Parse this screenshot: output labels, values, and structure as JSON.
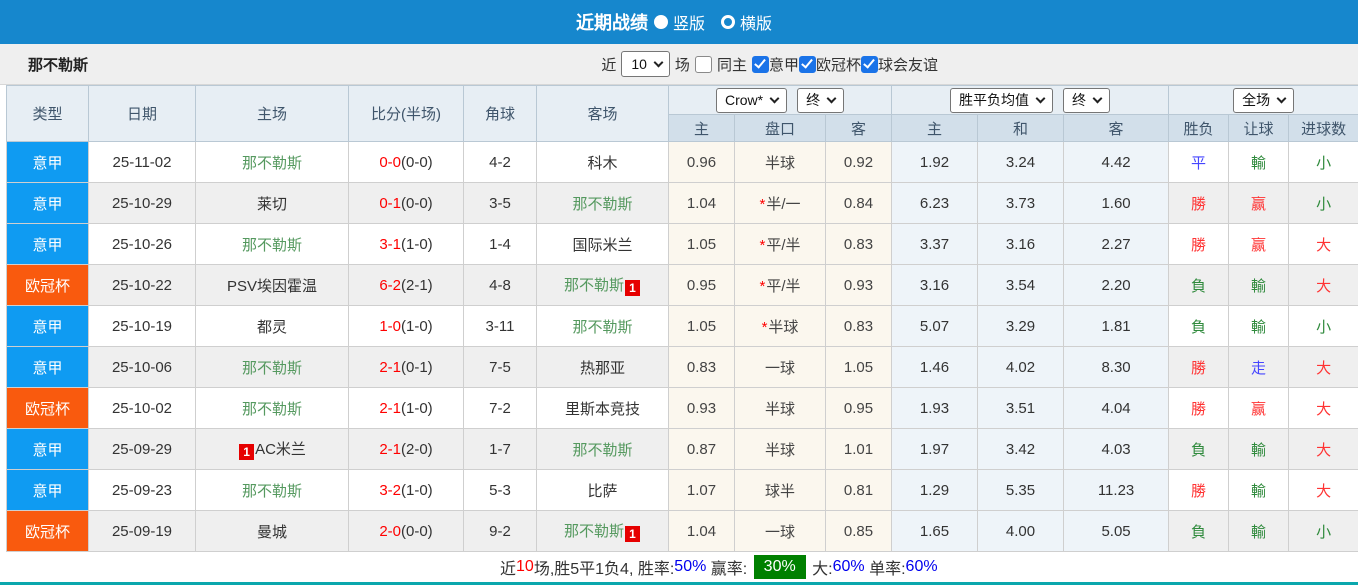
{
  "topbar": {
    "title": "近期战绩",
    "options": [
      {
        "label": "竖版",
        "selected": true
      },
      {
        "label": "横版",
        "selected": false
      }
    ]
  },
  "filterbar": {
    "team": "那不勒斯",
    "recent_label": "近",
    "recent_value": "10",
    "unit_label": "场",
    "same_home_label": "同主",
    "same_home_checked": false,
    "league_filters": [
      {
        "label": "意甲",
        "checked": true
      },
      {
        "label": "欧冠杯",
        "checked": true
      },
      {
        "label": "球会友谊",
        "checked": true
      }
    ]
  },
  "table": {
    "headers": {
      "type": "类型",
      "date": "日期",
      "home": "主场",
      "score": "比分(半场)",
      "corner": "角球",
      "away": "客场",
      "odds_home": "主",
      "handicap": "盘口",
      "odds_away": "客",
      "mean_home": "主",
      "mean_draw": "和",
      "mean_away": "客",
      "result": "胜负",
      "handicap_result": "让球",
      "goals": "进球数"
    },
    "selects": {
      "company": "Crow*",
      "company_time": "终",
      "mean": "胜平负均值",
      "mean_time": "终",
      "scope": "全场"
    },
    "rows": [
      {
        "league": "意甲",
        "league_color": "#0f9bf2",
        "date": "25-11-02",
        "home": {
          "name": "那不勒斯",
          "highlight": true
        },
        "score": "0-0",
        "half_score": "(0-0)",
        "corners": "4-2",
        "away": {
          "name": "科木",
          "highlight": false
        },
        "odds": {
          "home": "0.96",
          "star": false,
          "handicap": "半球",
          "away": "0.92"
        },
        "mean": {
          "home": "1.92",
          "draw": "3.24",
          "away": "4.42"
        },
        "results": {
          "outcome": {
            "text": "平",
            "color": "blue"
          },
          "handicap": {
            "text": "輸",
            "color": "green"
          },
          "goals": {
            "text": "小",
            "color": "green"
          }
        }
      },
      {
        "league": "意甲",
        "league_color": "#0f9bf2",
        "date": "25-10-29",
        "home": {
          "name": "莱切",
          "highlight": false
        },
        "score": "0-1",
        "half_score": "(0-0)",
        "corners": "3-5",
        "away": {
          "name": "那不勒斯",
          "highlight": true
        },
        "odds": {
          "home": "1.04",
          "star": true,
          "handicap": "半/一",
          "away": "0.84"
        },
        "mean": {
          "home": "6.23",
          "draw": "3.73",
          "away": "1.60"
        },
        "results": {
          "outcome": {
            "text": "勝",
            "color": "red"
          },
          "handicap": {
            "text": "赢",
            "color": "red"
          },
          "goals": {
            "text": "小",
            "color": "green"
          }
        }
      },
      {
        "league": "意甲",
        "league_color": "#0f9bf2",
        "date": "25-10-26",
        "home": {
          "name": "那不勒斯",
          "highlight": true
        },
        "score": "3-1",
        "half_score": "(1-0)",
        "corners": "1-4",
        "away": {
          "name": "国际米兰",
          "highlight": false
        },
        "odds": {
          "home": "1.05",
          "star": true,
          "handicap": "平/半",
          "away": "0.83"
        },
        "mean": {
          "home": "3.37",
          "draw": "3.16",
          "away": "2.27"
        },
        "results": {
          "outcome": {
            "text": "勝",
            "color": "red"
          },
          "handicap": {
            "text": "赢",
            "color": "red"
          },
          "goals": {
            "text": "大",
            "color": "red"
          }
        }
      },
      {
        "league": "欧冠杯",
        "league_color": "#f95a0e",
        "date": "25-10-22",
        "home": {
          "name": "PSV埃因霍温",
          "highlight": false
        },
        "score": "6-2",
        "half_score": "(2-1)",
        "corners": "4-8",
        "away": {
          "name": "那不勒斯",
          "highlight": true,
          "badge": {
            "text": "1",
            "position": "after"
          }
        },
        "odds": {
          "home": "0.95",
          "star": true,
          "handicap": "平/半",
          "away": "0.93"
        },
        "mean": {
          "home": "3.16",
          "draw": "3.54",
          "away": "2.20"
        },
        "results": {
          "outcome": {
            "text": "負",
            "color": "green"
          },
          "handicap": {
            "text": "輸",
            "color": "green"
          },
          "goals": {
            "text": "大",
            "color": "red"
          }
        }
      },
      {
        "league": "意甲",
        "league_color": "#0f9bf2",
        "date": "25-10-19",
        "home": {
          "name": "都灵",
          "highlight": false
        },
        "score": "1-0",
        "half_score": "(1-0)",
        "corners": "3-11",
        "away": {
          "name": "那不勒斯",
          "highlight": true
        },
        "odds": {
          "home": "1.05",
          "star": true,
          "handicap": "半球",
          "away": "0.83"
        },
        "mean": {
          "home": "5.07",
          "draw": "3.29",
          "away": "1.81"
        },
        "results": {
          "outcome": {
            "text": "負",
            "color": "green"
          },
          "handicap": {
            "text": "輸",
            "color": "green"
          },
          "goals": {
            "text": "小",
            "color": "green"
          }
        }
      },
      {
        "league": "意甲",
        "league_color": "#0f9bf2",
        "date": "25-10-06",
        "home": {
          "name": "那不勒斯",
          "highlight": true
        },
        "score": "2-1",
        "half_score": "(0-1)",
        "corners": "7-5",
        "away": {
          "name": "热那亚",
          "highlight": false
        },
        "odds": {
          "home": "0.83",
          "star": false,
          "handicap": "一球",
          "away": "1.05"
        },
        "mean": {
          "home": "1.46",
          "draw": "4.02",
          "away": "8.30"
        },
        "results": {
          "outcome": {
            "text": "勝",
            "color": "red"
          },
          "handicap": {
            "text": "走",
            "color": "blue"
          },
          "goals": {
            "text": "大",
            "color": "red"
          }
        }
      },
      {
        "league": "欧冠杯",
        "league_color": "#f95a0e",
        "date": "25-10-02",
        "home": {
          "name": "那不勒斯",
          "highlight": true
        },
        "score": "2-1",
        "half_score": "(1-0)",
        "corners": "7-2",
        "away": {
          "name": "里斯本竞技",
          "highlight": false
        },
        "odds": {
          "home": "0.93",
          "star": false,
          "handicap": "半球",
          "away": "0.95"
        },
        "mean": {
          "home": "1.93",
          "draw": "3.51",
          "away": "4.04"
        },
        "results": {
          "outcome": {
            "text": "勝",
            "color": "red"
          },
          "handicap": {
            "text": "赢",
            "color": "red"
          },
          "goals": {
            "text": "大",
            "color": "red"
          }
        }
      },
      {
        "league": "意甲",
        "league_color": "#0f9bf2",
        "date": "25-09-29",
        "home": {
          "name": "AC米兰",
          "highlight": false,
          "badge": {
            "text": "1",
            "position": "before"
          }
        },
        "score": "2-1",
        "half_score": "(2-0)",
        "corners": "1-7",
        "away": {
          "name": "那不勒斯",
          "highlight": true
        },
        "odds": {
          "home": "0.87",
          "star": false,
          "handicap": "半球",
          "away": "1.01"
        },
        "mean": {
          "home": "1.97",
          "draw": "3.42",
          "away": "4.03"
        },
        "results": {
          "outcome": {
            "text": "負",
            "color": "green"
          },
          "handicap": {
            "text": "輸",
            "color": "green"
          },
          "goals": {
            "text": "大",
            "color": "red"
          }
        }
      },
      {
        "league": "意甲",
        "league_color": "#0f9bf2",
        "date": "25-09-23",
        "home": {
          "name": "那不勒斯",
          "highlight": true
        },
        "score": "3-2",
        "half_score": "(1-0)",
        "corners": "5-3",
        "away": {
          "name": "比萨",
          "highlight": false
        },
        "odds": {
          "home": "1.07",
          "star": false,
          "handicap": "球半",
          "away": "0.81"
        },
        "mean": {
          "home": "1.29",
          "draw": "5.35",
          "away": "11.23"
        },
        "results": {
          "outcome": {
            "text": "勝",
            "color": "red"
          },
          "handicap": {
            "text": "輸",
            "color": "green"
          },
          "goals": {
            "text": "大",
            "color": "red"
          }
        }
      },
      {
        "league": "欧冠杯",
        "league_color": "#f95a0e",
        "date": "25-09-19",
        "home": {
          "name": "曼城",
          "highlight": false
        },
        "score": "2-0",
        "half_score": "(0-0)",
        "corners": "9-2",
        "away": {
          "name": "那不勒斯",
          "highlight": true,
          "badge": {
            "text": "1",
            "position": "after"
          }
        },
        "odds": {
          "home": "1.04",
          "star": false,
          "handicap": "一球",
          "away": "0.85"
        },
        "mean": {
          "home": "1.65",
          "draw": "4.00",
          "away": "5.05"
        },
        "results": {
          "outcome": {
            "text": "負",
            "color": "green"
          },
          "handicap": {
            "text": "輸",
            "color": "green"
          },
          "goals": {
            "text": "小",
            "color": "green"
          }
        }
      }
    ]
  },
  "summary": {
    "segments": [
      {
        "text": "近",
        "style": "dark"
      },
      {
        "text": "10",
        "style": "red"
      },
      {
        "text": "场,胜5平1负4, 胜率:",
        "style": "dark"
      },
      {
        "text": "50%",
        "style": "blue"
      },
      {
        "text": " 赢率: ",
        "style": "dark"
      },
      {
        "text": "30%",
        "style": "greenbox"
      },
      {
        "text": " 大:",
        "style": "dark"
      },
      {
        "text": "60%",
        "style": "blue"
      },
      {
        "text": " 单率:",
        "style": "dark"
      },
      {
        "text": "60%",
        "style": "blue"
      }
    ]
  },
  "colors": {
    "topbar_blue": "#1687cd",
    "serie_a_blue": "#0f9bf2",
    "ucl_orange": "#f95a0e",
    "header_bg": "#d2dfea",
    "stripe_gray": "#efefef",
    "odds_cream": "#fbf7ee",
    "mean_blue": "#eef4f9",
    "team_green": "#55995f",
    "win_red": "#ff3333",
    "lose_green": "#2f8a3c",
    "draw_blue": "#4646ff",
    "summary_green_bg": "#008000"
  }
}
